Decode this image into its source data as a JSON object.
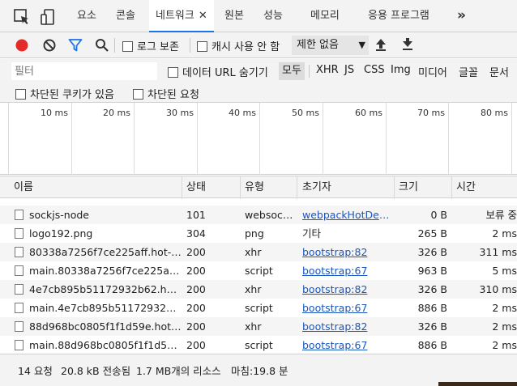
{
  "tabs": [
    {
      "label": "요소"
    },
    {
      "label": "콘솔"
    },
    {
      "label": "네트워크",
      "close": "✕"
    },
    {
      "label": "원본"
    },
    {
      "label": "성능"
    },
    {
      "label": "메모리"
    },
    {
      "label": "응용 프로그램"
    }
  ],
  "tabs_more": "»",
  "toolbar": {
    "preserve_log": "로그 보존",
    "disable_cache": "캐시 사용 안 함",
    "throttle": "제한 없음",
    "throttle_arrow": "▼"
  },
  "filter": {
    "placeholder": "필터",
    "hide_data_urls": "데이터 URL 숨기기",
    "types": [
      "모두",
      "XHR",
      "JS",
      "CSS",
      "Img",
      "미디어",
      "글꼴",
      "문서"
    ],
    "selected_type": "모두",
    "blocked_cookies": "차단된 쿠키가 있음",
    "blocked_requests": "차단된 요청"
  },
  "overview": {
    "ticks": [
      "10 ms",
      "20 ms",
      "30 ms",
      "40 ms",
      "50 ms",
      "60 ms",
      "70 ms",
      "80 ms"
    ]
  },
  "table": {
    "headers": {
      "name": "이름",
      "status": "상태",
      "type": "유형",
      "initiator": "초기자",
      "size": "크기",
      "time": "시간"
    },
    "rows": [
      {
        "name": "sockjs-node",
        "status": "101",
        "type": "websock...",
        "initiator": "webpackHotDev...",
        "initiator_link": true,
        "size": "0 B",
        "time": "보류 중"
      },
      {
        "name": "logo192.png",
        "status": "304",
        "type": "png",
        "initiator": "기타",
        "initiator_link": false,
        "size": "265 B",
        "time": "2 ms"
      },
      {
        "name": "80338a7256f7ce225aff.hot-u...",
        "status": "200",
        "type": "xhr",
        "initiator": "bootstrap:82",
        "initiator_link": true,
        "size": "326 B",
        "time": "311 ms"
      },
      {
        "name": "main.80338a7256f7ce225aff.h...",
        "status": "200",
        "type": "script",
        "initiator": "bootstrap:67",
        "initiator_link": true,
        "size": "963 B",
        "time": "5 ms"
      },
      {
        "name": "4e7cb895b51172932b62.hot-...",
        "status": "200",
        "type": "xhr",
        "initiator": "bootstrap:82",
        "initiator_link": true,
        "size": "326 B",
        "time": "310 ms"
      },
      {
        "name": "main.4e7cb895b51172932b6...",
        "status": "200",
        "type": "script",
        "initiator": "bootstrap:67",
        "initiator_link": true,
        "size": "886 B",
        "time": "2 ms"
      },
      {
        "name": "88d968bc0805f1f1d59e.hot-u...",
        "status": "200",
        "type": "xhr",
        "initiator": "bootstrap:82",
        "initiator_link": true,
        "size": "326 B",
        "time": "2 ms"
      },
      {
        "name": "main.88d968bc0805f1f1d59e....",
        "status": "200",
        "type": "script",
        "initiator": "bootstrap:67",
        "initiator_link": true,
        "size": "886 B",
        "time": "2 ms"
      }
    ]
  },
  "status": {
    "requests": "14 요청",
    "transferred": "20.8 kB 전송됨",
    "resources": "1.7 MB개의 리소스",
    "finish": "마침:19.8 분"
  },
  "colors": {
    "record": "#e52a2a",
    "filter_icon": "#1a73e8",
    "link": "#1a56c0"
  }
}
